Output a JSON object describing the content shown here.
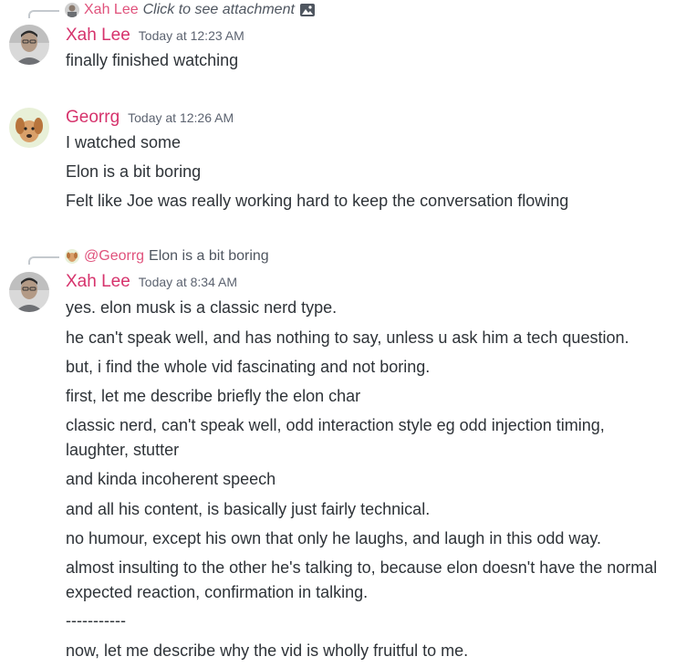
{
  "messages": [
    {
      "reply": {
        "author": "Xah Lee",
        "preview": "Click to see attachment",
        "icon": "image-icon"
      },
      "author": "Xah Lee",
      "timestamp": "Today at 12:23 AM",
      "lines": [
        "finally finished watching"
      ]
    },
    {
      "author": "Georrg",
      "timestamp": "Today at 12:26 AM",
      "lines": [
        "I watched some",
        "Elon is a bit boring",
        "Felt like Joe was really working hard to keep the conversation flowing"
      ]
    },
    {
      "reply": {
        "author": "@Georrg",
        "preview": "Elon is a bit boring"
      },
      "author": "Xah Lee",
      "timestamp": "Today at 8:34 AM",
      "lines": [
        "yes. elon musk is a classic nerd type.",
        "he can't speak well, and has nothing to say, unless u ask him a tech question.",
        "but, i find the whole vid fascinating and not boring.",
        "first, let me describe briefly the elon char",
        "classic nerd, can't speak well, odd interaction style eg odd injection timing, laughter, stutter",
        "and kinda incoherent speech",
        "and all his content, is basically just fairly technical.",
        "no humour, except his own that only he laughs, and laugh in this odd way.",
        "almost insulting to the other he's talking to, because elon doesn't have the normal expected reaction, confirmation in talking.",
        "-----------",
        "now, let me describe why the vid is wholly fruitful to me."
      ]
    }
  ],
  "colors": {
    "username": "#d6336c",
    "reply_author": "#e0527c",
    "text": "#2e3338",
    "timestamp": "#5c6370"
  }
}
